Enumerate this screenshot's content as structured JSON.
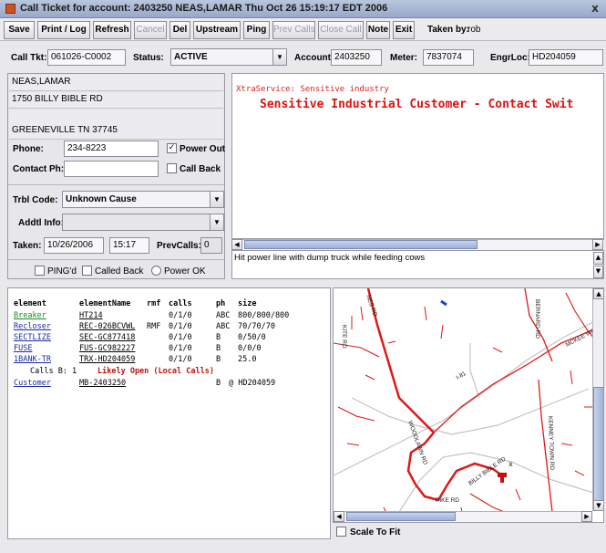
{
  "window": {
    "title": "Call Ticket for account: 2403250   NEAS,LAMAR   Thu Oct 26 15:19:17 EDT 2006",
    "close_glyph": "x"
  },
  "toolbar": {
    "buttons": [
      {
        "label": "Save",
        "enabled": true
      },
      {
        "label": "Print / Log",
        "enabled": true
      },
      {
        "label": "Refresh",
        "enabled": true
      },
      {
        "label": "Cancel",
        "enabled": false
      },
      {
        "label": "Del",
        "enabled": true
      },
      {
        "label": "Upstream",
        "enabled": true
      },
      {
        "label": "Ping",
        "enabled": true
      },
      {
        "label": "Prev Calls",
        "enabled": false
      },
      {
        "label": "Close Call",
        "enabled": false
      },
      {
        "label": "Note",
        "enabled": true
      },
      {
        "label": "Exit",
        "enabled": true
      }
    ],
    "taken_by_label": "Taken by:",
    "taken_by_value": "rob"
  },
  "ticket": {
    "call_tkt_label": "Call Tkt:",
    "call_tkt_value": "061026-C0002",
    "status_label": "Status:",
    "status_value": "ACTIVE",
    "account_label": "Account:",
    "account_value": "2403250",
    "meter_label": "Meter:",
    "meter_value": "7837074",
    "engrloc_label": "EngrLoc:",
    "engrloc_value": "HD204059"
  },
  "customer": {
    "name": "NEAS,LAMAR",
    "address1": "1750 BILLY BIBLE RD",
    "address2": "",
    "city_state_zip": "GREENEVILLE   TN 37745",
    "phone_label": "Phone:",
    "phone_value": "234-8223",
    "power_out_label": "Power Out",
    "power_out_checked": true,
    "contact_label": "Contact Ph:",
    "contact_value": "",
    "call_back_label": "Call Back",
    "call_back_checked": false,
    "trbl_label": "Trbl Code:",
    "trbl_value": "Unknown Cause",
    "addtl_label": "Addtl Info:",
    "addtl_value": "",
    "taken_label": "Taken:",
    "taken_date": "10/26/2006",
    "taken_time": "15:17",
    "prevcalls_label": "PrevCalls:",
    "prevcalls_value": "0",
    "pingd_label": "PING'd",
    "called_back_label": "Called Back",
    "power_ok_label": "Power OK"
  },
  "notes": {
    "line1": "XtraService: Sensitive industry",
    "line2": "Sensitive Industrial Customer - Contact Swit",
    "line1_color": "#e02020",
    "line2_color": "#e01010"
  },
  "comment": "Hit power line with dump truck while feeding cows",
  "grid": {
    "headers": [
      "element",
      "elementName",
      "rmf",
      "calls",
      "ph",
      "size"
    ],
    "rows": [
      {
        "element": "Breaker",
        "name": "HT214",
        "rmf": "",
        "calls": "0/1/0",
        "ph": "ABC",
        "size": "800/800/800",
        "link_color": "green"
      },
      {
        "element": "Recloser",
        "name": "REC-026BCVWL",
        "rmf": "RMF",
        "calls": "0/1/0",
        "ph": "ABC",
        "size": "70/70/70",
        "link_color": "blue"
      },
      {
        "element": "SECTLIZE",
        "name": "SEC-GC877418",
        "rmf": "",
        "calls": "0/1/0",
        "ph": "B",
        "size": "0/50/0",
        "link_color": "blue"
      },
      {
        "element": "FUSE",
        "name": "FUS-GC982227",
        "rmf": "",
        "calls": "0/1/0",
        "ph": "B",
        "size": "0/0/0",
        "link_color": "blue"
      },
      {
        "element": "1BANK-TR",
        "name": "TRX-HD204059",
        "rmf": "",
        "calls": "0/1/0",
        "ph": "B",
        "size": "25.0",
        "link_color": "blue"
      }
    ],
    "calls_line_prefix": "Calls B: 1",
    "calls_line_status": "Likely Open (Local Calls)",
    "calls_line_status_color": "#c01010",
    "customer_row": {
      "element": "Customer",
      "name": "MB-2403250",
      "ph": "B",
      "size": "@ HD204059"
    }
  },
  "map": {
    "road_labels": [
      "NES RD",
      "KITE RD",
      "BERNARD RD",
      "MCKEE WAY",
      "I-81",
      "WOODLAWN RD",
      "BILLY BIBLE RD",
      "KENNEY TOWN RD",
      "PIKE RD"
    ],
    "line_color": "#e01818",
    "road_color": "#c8c8c8",
    "scale_to_fit_label": "Scale To Fit",
    "scale_to_fit_checked": false
  },
  "icons": {
    "scroll_left": "◀",
    "scroll_right": "▶",
    "scroll_up": "▲",
    "scroll_down": "▼",
    "combo_arrow": "▼",
    "check_mark": "✓",
    "grip": "|||"
  }
}
